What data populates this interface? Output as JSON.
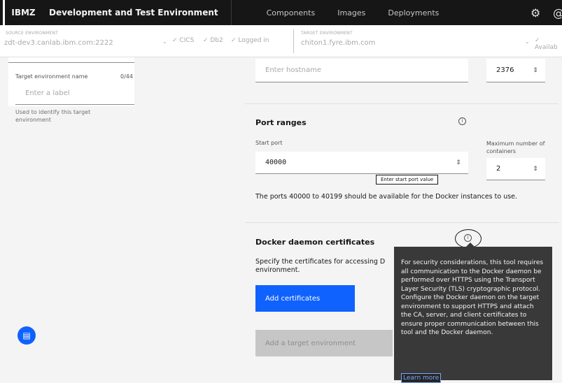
{
  "topbar": {
    "brand": "IBMZ",
    "app_title": "Development and Test Environment",
    "nav": [
      "Components",
      "Images",
      "Deployments"
    ],
    "settings_icon": "gear-icon",
    "user_icon": "user-icon",
    "user_icon_glyph": "@"
  },
  "envbar": {
    "source_label": "SOURCE ENVIRONMENT",
    "source_value": "zdt-dev3.canlab.ibm.com:2222",
    "status_cics": "CICS",
    "status_db2": "Db2",
    "status_logged": "Logged in",
    "target_label": "TARGET ENVIRONMENT",
    "target_value": "chiton1.fyre.ibm.com",
    "available": "Availab"
  },
  "left": {
    "name_label": "Target environment name",
    "name_count": "0/44",
    "name_placeholder": "Enter a label",
    "helper": "Used to identify this target environment"
  },
  "host": {
    "placeholder": "Enter hostname",
    "port": "2376"
  },
  "ports": {
    "title": "Port ranges",
    "start_label": "Start port",
    "start_value": "40000",
    "max_label": "Maximum number of containers",
    "max_value": "2",
    "start_tip": "Enter start port value",
    "note": "The ports 40000 to 40199 should be available for the Docker instances to use."
  },
  "certs": {
    "title": "Docker daemon certificates",
    "desc_line1": "Specify the certificates for accessing D",
    "desc_line2": "environment.",
    "add_button": "Add certificates"
  },
  "submit_button": "Add a target environment",
  "tooltip": {
    "text": "For security considerations, this tool requires all communication to the Docker daemon be performed over HTTPS using the Transport Layer Security (TLS) cryptographic protocol. Configure the Docker daemon on the target environment to support HTTPS and attach the CA, server, and client certificates to ensure proper communication between this tool and the Docker daemon.",
    "learn_more": "Learn more"
  },
  "chat_icon": "chat-icon",
  "colors": {
    "primary": "#0f62fe",
    "topbar": "#161616",
    "tooltip": "#393939"
  }
}
